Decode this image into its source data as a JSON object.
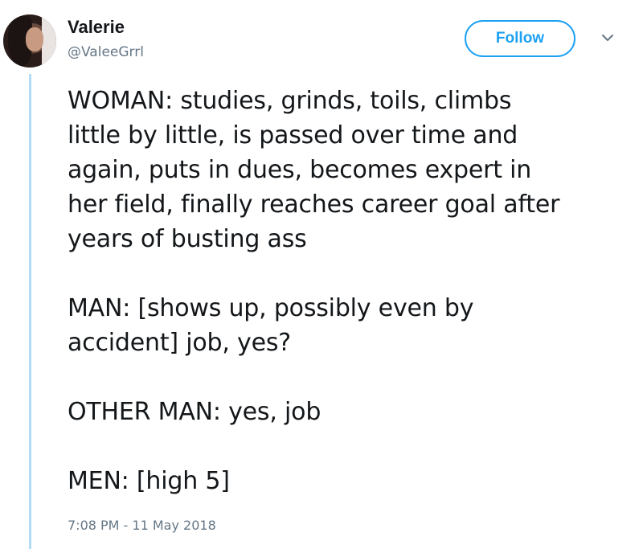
{
  "author": {
    "name": "Valerie",
    "handle": "@ValeeGrrl"
  },
  "follow_button": {
    "label": "Follow"
  },
  "menu_icon": "chevron-down-icon",
  "colors": {
    "accent": "#1da1f2",
    "text": "#14171a",
    "muted": "#657786",
    "thread_line": "#b1dcf6"
  },
  "tweet": {
    "paragraphs": [
      [
        "WOMAN: studies, grinds, toils, climbs",
        "little by little, is passed over time and",
        "again, puts in dues, becomes expert in",
        "her field, finally reaches career goal after",
        "years of busting ass"
      ],
      [
        "MAN: [shows up, possibly even by",
        "accident] job, yes?"
      ],
      [
        "OTHER MAN: yes, job"
      ],
      [
        "MEN: [high 5]"
      ]
    ],
    "timestamp": "7:08 PM - 11 May 2018"
  }
}
